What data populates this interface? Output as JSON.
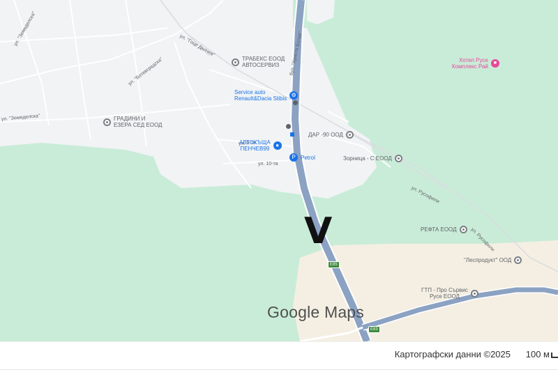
{
  "map": {
    "marker_label": "V",
    "logo_text": "Google Maps",
    "road_shields": [
      "E85",
      "E83"
    ],
    "streets": [
      "ул. \"Земеделска\"",
      "ул. \"Земеделска\"",
      "ул. \"Гоце Делчев\"",
      "бул. \"Христо Ботев\"",
      "ул. 9-та",
      "ул. 10-та",
      "ул. Русофили",
      "ул. Русофили",
      "ул. \"Ботевградска\""
    ],
    "places": [
      {
        "name": "ТРАБЕКС ЕООД\nАВТОСЕРВИЗ",
        "kind": "grey"
      },
      {
        "name": "Service auto\nRenault&Dacia Stibis",
        "kind": "blue"
      },
      {
        "name": "ГРАДИНИ И\nЕЗЕРА СЕД ЕООД",
        "kind": "grey"
      },
      {
        "name": "ДАР -90 ООД",
        "kind": "grey"
      },
      {
        "name": "АВТОКЪЩА\nПЕНЧЕВ99",
        "kind": "blue"
      },
      {
        "name": "Petrol",
        "kind": "blue"
      },
      {
        "name": "Зорница - С ЕООД",
        "kind": "grey"
      },
      {
        "name": "Хотел Русе\nКомплекс Рай",
        "kind": "pink"
      },
      {
        "name": "РЕФТА ЕООД",
        "kind": "grey"
      },
      {
        "name": "\"Леспродукт\" ООД",
        "kind": "grey"
      },
      {
        "name": "ГТП - Про Сървис\nРусе ЕООД",
        "kind": "grey"
      }
    ]
  },
  "footer": {
    "credits": "Картографски данни ©2025",
    "scale": "100 м"
  },
  "colors": {
    "park": "#c9ecd8",
    "urban": "#f1f3f4",
    "farmland": "#f5efe3",
    "highway": "#8ba2c3",
    "accent_blue": "#1a73e8",
    "accent_pink": "#e8489b"
  }
}
